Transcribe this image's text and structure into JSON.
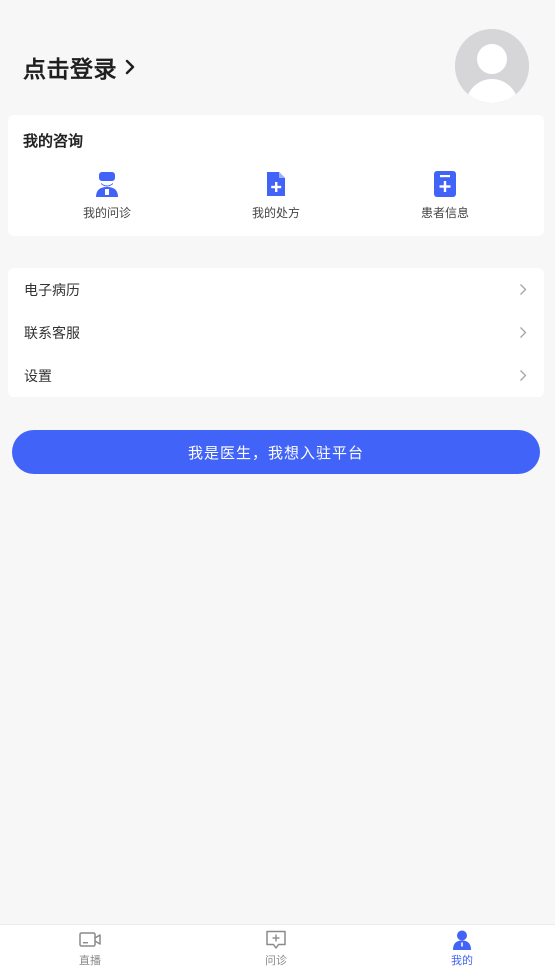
{
  "header": {
    "login_label": "点击登录",
    "login_chevron_icon": "chevron-right-icon",
    "avatar_icon": "default-user-avatar-icon"
  },
  "consult": {
    "title": "我的咨询",
    "items": [
      {
        "label": "我的问诊",
        "icon": "doctor-icon"
      },
      {
        "label": "我的处方",
        "icon": "prescription-file-plus-icon"
      },
      {
        "label": "患者信息",
        "icon": "patient-record-icon"
      }
    ]
  },
  "menu": {
    "items": [
      {
        "label": "电子病历"
      },
      {
        "label": "联系客服"
      },
      {
        "label": "设置"
      }
    ],
    "chevron_icon": "chevron-right-icon"
  },
  "cta": {
    "label": "我是医生，我想入驻平台"
  },
  "tabbar": {
    "items": [
      {
        "label": "直播",
        "icon": "video-camera-icon",
        "active": false
      },
      {
        "label": "问诊",
        "icon": "chat-plus-icon",
        "active": false
      },
      {
        "label": "我的",
        "icon": "user-icon",
        "active": true
      }
    ]
  },
  "colors": {
    "accent": "#4163f7",
    "background": "#f7f7f8",
    "inactive_tab": "#8a8a8a"
  }
}
